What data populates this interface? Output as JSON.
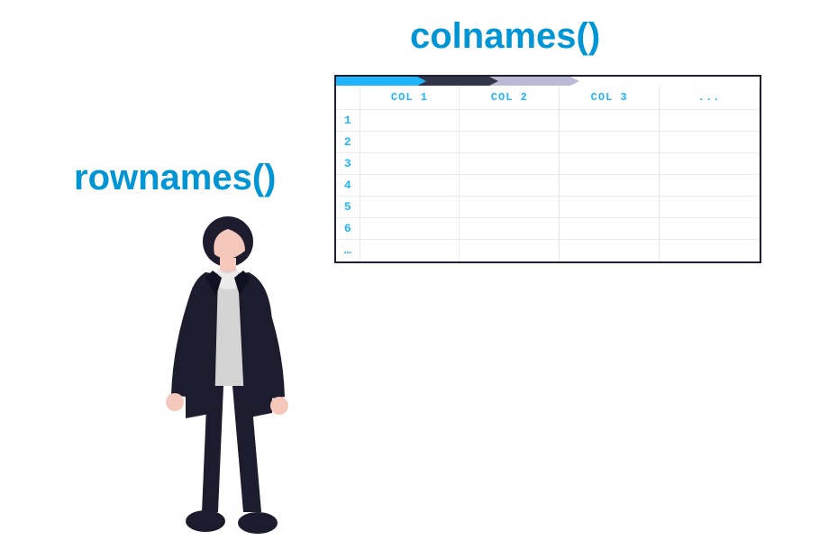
{
  "labels": {
    "colnames": "colnames()",
    "rownames": "rownames()"
  },
  "table": {
    "columns": [
      "COL 1",
      "COL 2",
      "COL 3",
      "..."
    ],
    "rows": [
      "1",
      "2",
      "3",
      "4",
      "5",
      "6",
      "…"
    ]
  },
  "colors": {
    "accent": "#0096d6",
    "tableAccent": "#1fb6ff",
    "tabDark": "#32344a",
    "tabLight": "#babad6",
    "border": "#1f2133"
  }
}
